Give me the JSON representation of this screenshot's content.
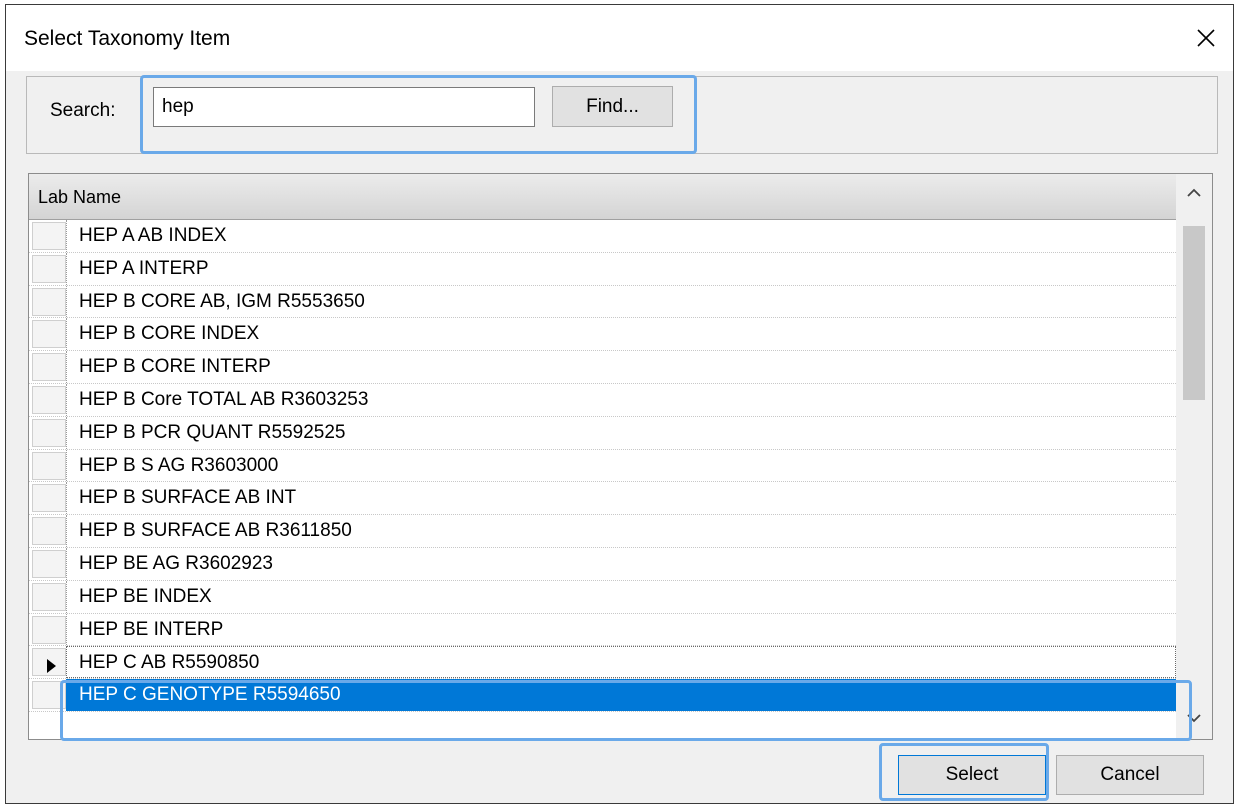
{
  "dialog": {
    "title": "Select Taxonomy Item",
    "close_icon": "close-icon"
  },
  "search": {
    "label": "Search:",
    "value": "hep",
    "find_label": "Find..."
  },
  "grid": {
    "column_header": "Lab Name",
    "current_row_index": 13,
    "selected_row_index": 14,
    "rows": [
      "HEP A AB INDEX",
      "HEP A INTERP",
      "HEP B CORE AB, IGM R5553650",
      "HEP B CORE INDEX",
      "HEP B CORE INTERP",
      "HEP B Core TOTAL AB R3603253",
      "HEP B PCR QUANT R5592525",
      "HEP B S AG R3603000",
      "HEP B SURFACE AB INT",
      "HEP B SURFACE AB R3611850",
      "HEP BE AG R3602923",
      "HEP BE INDEX",
      "HEP BE INTERP",
      "HEP C AB R5590850",
      "HEP C GENOTYPE R5594650"
    ]
  },
  "buttons": {
    "select_label": "Select",
    "cancel_label": "Cancel"
  },
  "colors": {
    "selection": "#0078d7",
    "callout": "#6aa9e9"
  }
}
